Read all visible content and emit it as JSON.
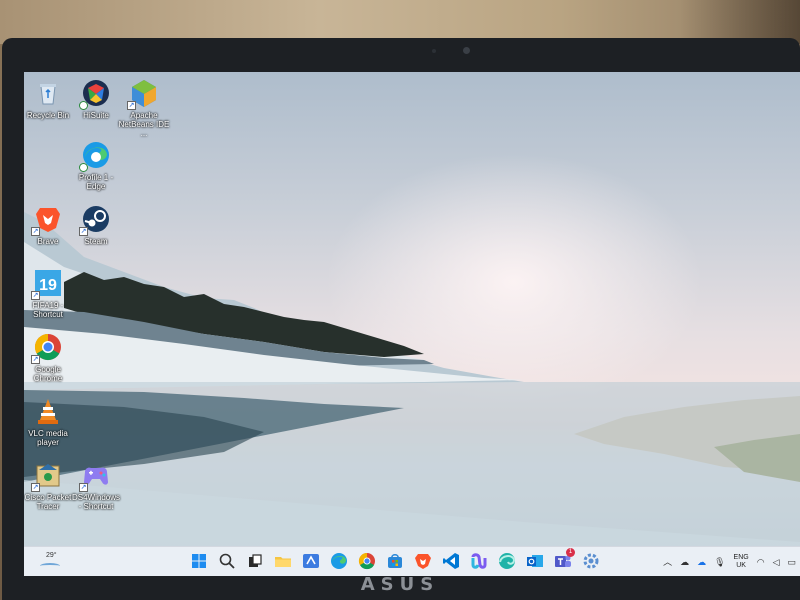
{
  "desktop": {
    "icons": [
      {
        "label": "Recycle Bin",
        "icon": "recycle-bin-icon"
      },
      {
        "label": "HiSuite",
        "icon": "hisuite-icon"
      },
      {
        "label": "Apache NetBeans IDE ...",
        "icon": "netbeans-icon"
      },
      {
        "label": "Profile 1 - Edge",
        "icon": "edge-icon"
      },
      {
        "label": "Brave",
        "icon": "brave-icon"
      },
      {
        "label": "Steam",
        "icon": "steam-icon"
      },
      {
        "label": "FIFA19 - Shortcut",
        "icon": "fifa19-icon"
      },
      {
        "label": "Google Chrome",
        "icon": "chrome-icon"
      },
      {
        "label": "VLC media player",
        "icon": "vlc-icon"
      },
      {
        "label": "Cisco Packet Tracer",
        "icon": "packet-tracer-icon"
      },
      {
        "label": "DS4Windows - Shortcut",
        "icon": "ds4windows-icon"
      }
    ]
  },
  "taskbar": {
    "weather": {
      "temp": "29°"
    },
    "apps": [
      {
        "name": "start-button",
        "icon": "windows-icon"
      },
      {
        "name": "search-button",
        "icon": "search-icon"
      },
      {
        "name": "task-view-button",
        "icon": "task-view-icon"
      },
      {
        "name": "file-explorer-button",
        "icon": "folder-icon"
      },
      {
        "name": "editor-app-button",
        "icon": "editor-icon"
      },
      {
        "name": "edge-button",
        "icon": "edge-icon"
      },
      {
        "name": "chrome-button",
        "icon": "chrome-icon"
      },
      {
        "name": "store-button",
        "icon": "store-icon"
      },
      {
        "name": "brave-button",
        "icon": "brave-icon"
      },
      {
        "name": "vscode-button",
        "icon": "vscode-icon"
      },
      {
        "name": "copilot-button",
        "icon": "copilot-icon"
      },
      {
        "name": "edge-dev-button",
        "icon": "edge-dev-icon"
      },
      {
        "name": "outlook-button",
        "icon": "outlook-icon"
      },
      {
        "name": "teams-button",
        "icon": "teams-icon",
        "badge": "1"
      },
      {
        "name": "settings-button",
        "icon": "gear-icon"
      }
    ],
    "tray": {
      "language_line1": "ENG",
      "language_line2": "UK"
    }
  },
  "bezel": {
    "logo": "ASUS"
  },
  "colors": {
    "taskbar_bg": "#eceff6",
    "accent_blue": "#1a73e8",
    "lake": "#a9c3cf"
  }
}
